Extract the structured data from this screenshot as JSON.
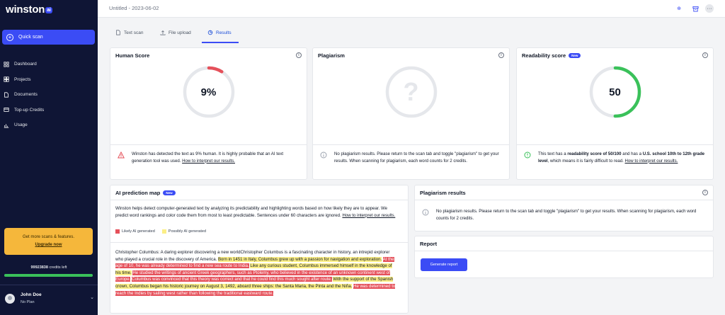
{
  "sidebar": {
    "logo": "winston",
    "logo_badge": "ai",
    "quick_scan": "Quick scan",
    "items": [
      {
        "label": "Dashboard",
        "icon": "grid-icon"
      },
      {
        "label": "Projects",
        "icon": "projects-icon"
      },
      {
        "label": "Documents",
        "icon": "document-icon"
      },
      {
        "label": "Top-up Credits",
        "icon": "credit-card-icon"
      },
      {
        "label": "Usage",
        "icon": "chart-icon"
      }
    ],
    "promo_text": "Get more scans & features.",
    "promo_link": "Upgrade now",
    "credits_value": "99923838",
    "credits_suffix": "credits left",
    "credits_fraction": 1.0,
    "user_name": "John Doe",
    "user_plan": "No Plan"
  },
  "topbar": {
    "doc_title": "Untitled - 2023-06-02"
  },
  "tabs": [
    {
      "label": "Text scan",
      "active": false
    },
    {
      "label": "File upload",
      "active": false
    },
    {
      "label": "Results",
      "active": true
    }
  ],
  "human_score": {
    "title": "Human Score",
    "value": "9%",
    "fraction": 0.09,
    "color": "#e5505a",
    "note_main": "Winston has detected the text as 9% human. It is highly probable that an AI text generation tool was used. ",
    "note_link": "How to interpret our results."
  },
  "plagiarism": {
    "title": "Plagiarism",
    "placeholder": "?",
    "note": "No plagiarism results. Please return to the scan tab and toggle \"plagiarism\" to get your results. When scanning for plagiarism, each word counts for 2 credits."
  },
  "readability": {
    "title": "Readability score",
    "badge": "New",
    "value": "50",
    "fraction": 0.5,
    "color": "#3ac15a",
    "note_1": "This text has a ",
    "note_2": "readability score of 50/100",
    "note_3": " and has a ",
    "note_4": "U.S. school 10th to 12th grade level",
    "note_5": ", which means it is fairly difficult to read. ",
    "note_link": "How to interpret our results."
  },
  "prediction_map": {
    "title": "AI prediction map",
    "badge": "New",
    "intro": "Winston helps detect computer-generated text by analyzing its predictability and highlighting words based on how likely they are to appear. We predict word rankings and color code them from most to least predictable. Sentences under 60 characters are ignored. ",
    "intro_link": "How to interpret our results.",
    "legend_likely": "Likely AI generated",
    "legend_possibly": "Possibly AI generated",
    "likely_color": "#e5505a",
    "possibly_color": "#fcef86",
    "segments": [
      {
        "text": "Christopher Columbus: A daring explorer discovering a new worldChristopher Columbus is a fascinating character in history, an intrepid explorer who played a crucial role in the discovery of America. ",
        "hl": "none"
      },
      {
        "text": "Born in 1451 in Italy, Columbus grew up with a passion for navigation and exploration.",
        "hl": "y"
      },
      {
        "text": " ",
        "hl": "none"
      },
      {
        "text": "At the age of 10, he was already determined to find a new sea route to India.",
        "hl": "r"
      },
      {
        "text": " ",
        "hl": "none"
      },
      {
        "text": "Like any curious student, Columbus immersed himself in the knowledge of his time.",
        "hl": "y"
      },
      {
        "text": " ",
        "hl": "none"
      },
      {
        "text": "He studied the writings of ancient Greek geographers, such as Ptolemy, who believed in the existence of an unknown continent west of Europe.",
        "hl": "r"
      },
      {
        "text": " ",
        "hl": "none"
      },
      {
        "text": "Columbus was convinced that this theory was correct and that he could find this much sought after route.",
        "hl": "r"
      },
      {
        "text": " ",
        "hl": "none"
      },
      {
        "text": "With the support of the Spanish crown, Columbus began his historic journey on August 3, 1492, aboard three ships: the Santa Maria, the Pinta and the Niña.",
        "hl": "y"
      },
      {
        "text": " ",
        "hl": "none"
      },
      {
        "text": "He was determined to reach the Indies by sailing west rather than following the traditional eastward route.",
        "hl": "r"
      }
    ]
  },
  "plagiarism_results": {
    "title": "Plagiarism results",
    "note": "No plagiarism results. Please return to the scan tab and toggle \"plagiarism\" to get your results. When scanning for plagiarism, each word counts for 2 credits."
  },
  "report": {
    "title": "Report",
    "button": "Generate report"
  }
}
